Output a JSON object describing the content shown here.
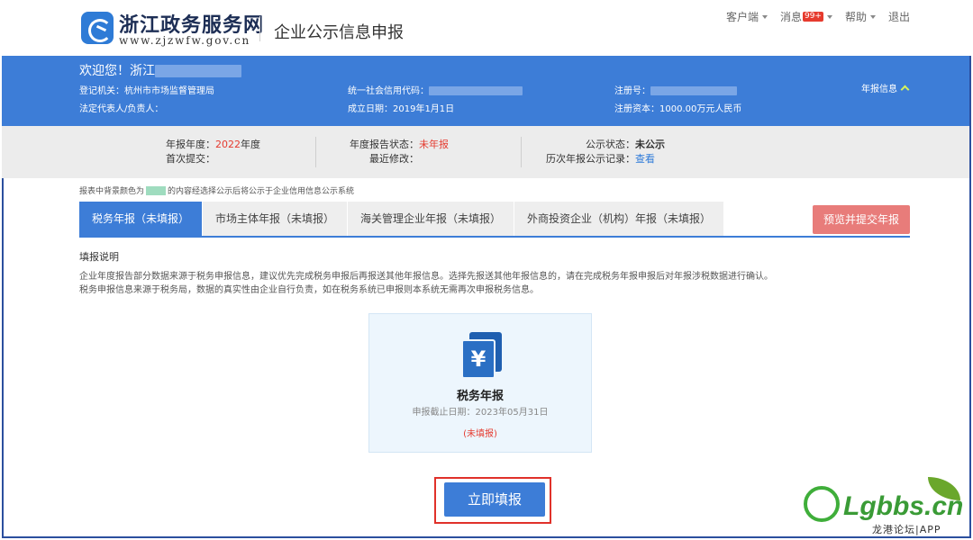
{
  "header": {
    "site_name": "浙江政务服务网",
    "site_url": "www.zjzwfw.gov.cn",
    "app_title": "企业公示信息申报",
    "nav": {
      "client": "客户端",
      "messages": "消息",
      "message_badge": "99+",
      "help": "帮助",
      "logout": "退出"
    }
  },
  "banner": {
    "welcome": "欢迎您！浙江",
    "registration_authority": "登记机关：杭州市市场监督管理局",
    "legal_rep": "法定代表人/负责人：",
    "credit_code_label": "统一社会信用代码：",
    "established": "成立日期：2019年1月1日",
    "reg_no_label": "注册号：",
    "reg_capital": "注册资本：1000.00万元人民币",
    "year_info": "年报信息"
  },
  "status": {
    "year_label": "年报年度：",
    "year_value": "2022",
    "year_suffix": "年度",
    "first_submit": "首次提交：",
    "report_status_label": "年度报告状态：",
    "report_status_value": "未年报",
    "last_modified": "最近修改：",
    "public_status_label": "公示状态：",
    "public_status_value": "未公示",
    "history_label": "历次年报公示记录：",
    "history_link": "查看"
  },
  "notice": {
    "prefix": "报表中背景颜色为",
    "suffix": "的内容经选择公示后将公示于企业信用信息公示系统",
    "swatch_color": "#9fdcbf"
  },
  "tabs": [
    {
      "label": "税务年报（未填报）",
      "active": true
    },
    {
      "label": "市场主体年报（未填报）",
      "active": false
    },
    {
      "label": "海关管理企业年报（未填报）",
      "active": false
    },
    {
      "label": "外商投资企业（机构）年报（未填报）",
      "active": false
    }
  ],
  "preview_button": "预览并提交年报",
  "instructions": {
    "title": "填报说明",
    "line1": "企业年度报告部分数据来源于税务申报信息，建议优先完成税务申报后再报送其他年报信息。选择先报送其他年报信息的，请在完成税务年报申报后对年报涉税数据进行确认。",
    "line2": "税务申报信息来源于税务局，数据的真实性由企业自行负责，如在税务系统已申报则本系统无需再次申报税务信息。"
  },
  "card": {
    "icon": "yen-document-icon",
    "title": "税务年报",
    "deadline": "申报截止日期：2023年05月31日",
    "status": "(未填报)"
  },
  "fill_button": "立即填报",
  "watermark": {
    "text": "Lgbbs.cn",
    "sub": "龙港论坛|APP"
  },
  "colors": {
    "primary": "#3d7dd7",
    "danger": "#e53b30",
    "preview_button": "#e87c7a",
    "highlight_outline": "#e0312a"
  }
}
